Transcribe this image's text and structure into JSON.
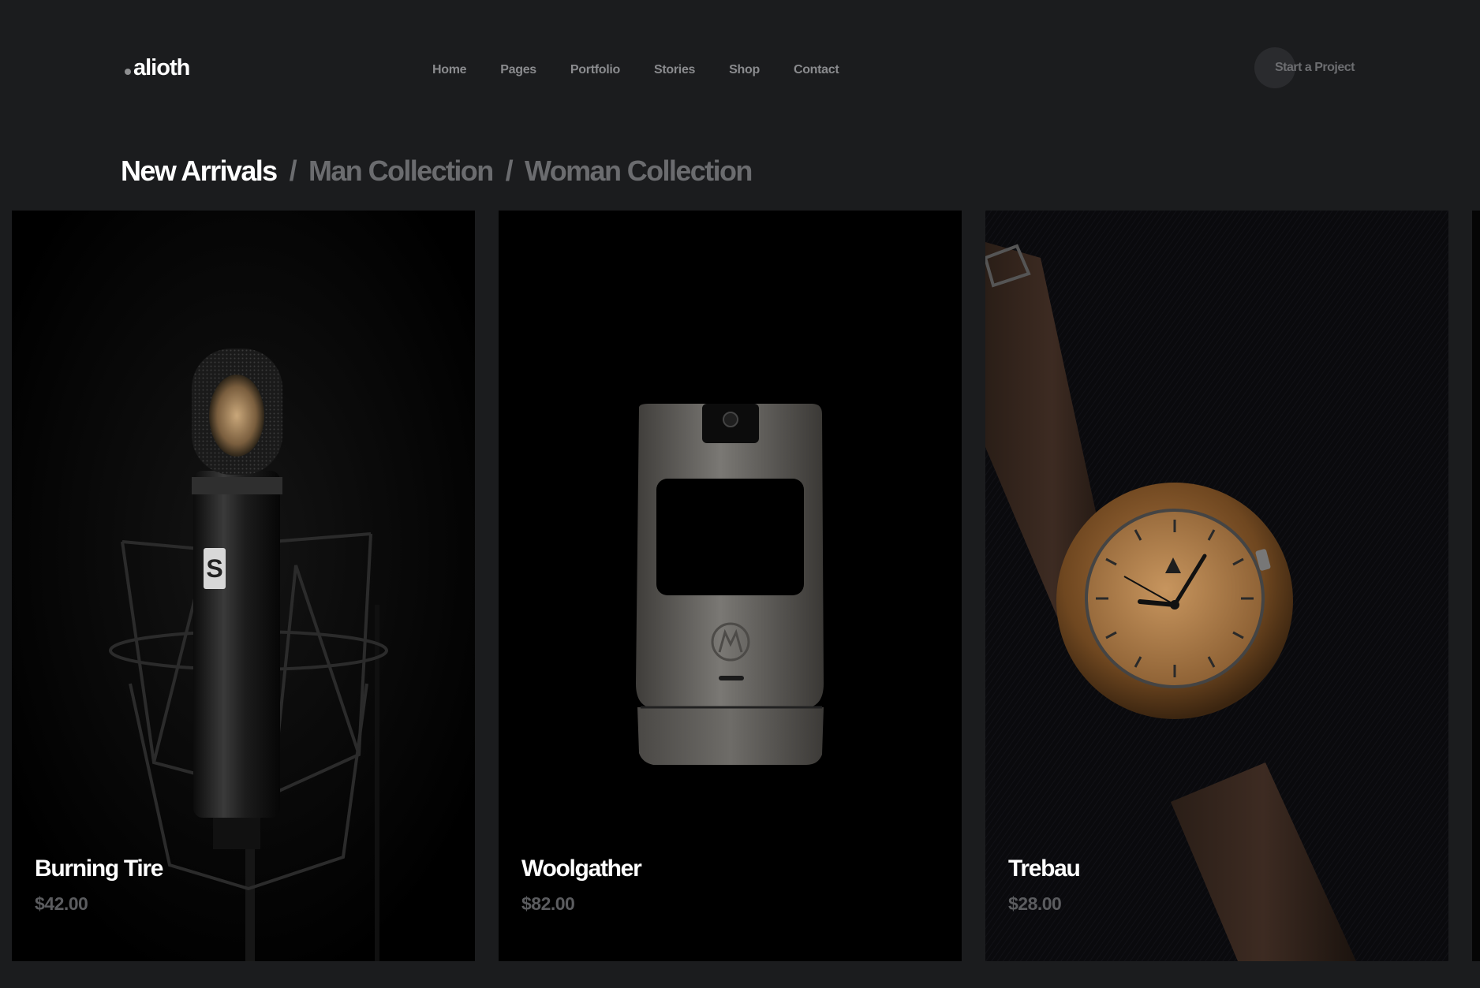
{
  "brand": {
    "name": "alioth"
  },
  "nav": {
    "items": [
      {
        "label": "Home"
      },
      {
        "label": "Pages"
      },
      {
        "label": "Portfolio"
      },
      {
        "label": "Stories"
      },
      {
        "label": "Shop"
      },
      {
        "label": "Contact"
      }
    ]
  },
  "cta": {
    "label": "Start a Project"
  },
  "collections": {
    "tabs": [
      {
        "label": "New Arrivals",
        "active": true
      },
      {
        "label": "Man Collection",
        "active": false
      },
      {
        "label": "Woman Collection",
        "active": false
      }
    ],
    "separator": "/"
  },
  "products": [
    {
      "name": "Burning Tire",
      "price": "$42.00",
      "image": "microphone-photo"
    },
    {
      "name": "Woolgather",
      "price": "$82.00",
      "image": "flip-phone-photo"
    },
    {
      "name": "Trebau",
      "price": "$28.00",
      "image": "wooden-watch-photo"
    }
  ],
  "colors": {
    "background": "#1b1c1e",
    "text_primary": "#ffffff",
    "text_muted": "#6b6c6f",
    "card_background": "#000000"
  }
}
